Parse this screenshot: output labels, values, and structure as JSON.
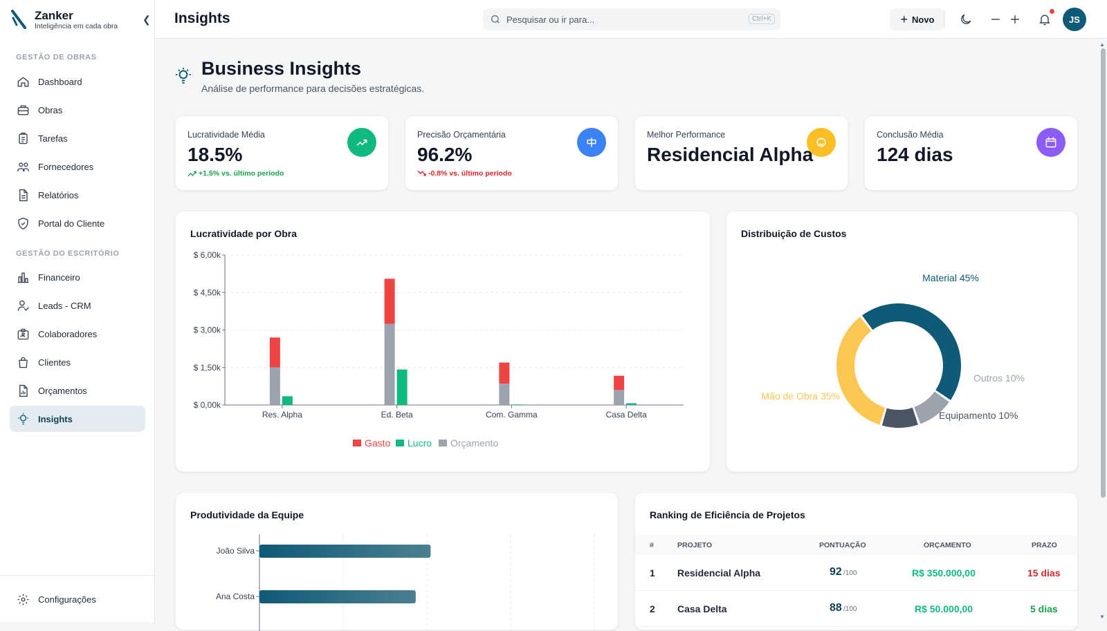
{
  "brand": {
    "name": "Zanker",
    "tagline": "Inteligência em cada obra"
  },
  "sidebar": {
    "section1": "GESTÃO DE OBRAS",
    "section2": "GESTÃO DO ESCRITÓRIO",
    "items": [
      {
        "label": "Dashboard",
        "icon": "home-icon"
      },
      {
        "label": "Obras",
        "icon": "briefcase-icon"
      },
      {
        "label": "Tarefas",
        "icon": "clipboard-icon"
      },
      {
        "label": "Fornecedores",
        "icon": "users-icon"
      },
      {
        "label": "Relatórios",
        "icon": "file-icon"
      },
      {
        "label": "Portal do Cliente",
        "icon": "shield-icon"
      },
      {
        "label": "Financeiro",
        "icon": "bar-chart-icon"
      },
      {
        "label": "Leads - CRM",
        "icon": "user-handshake-icon"
      },
      {
        "label": "Colaboradores",
        "icon": "id-badge-icon"
      },
      {
        "label": "Clientes",
        "icon": "shopping-bag-icon"
      },
      {
        "label": "Orçamentos",
        "icon": "file-chart-icon"
      },
      {
        "label": "Insights",
        "icon": "lightbulb-icon",
        "active": true
      }
    ],
    "settings": "Configurações"
  },
  "topbar": {
    "title": "Insights",
    "search_placeholder": "Pesquisar ou ir para...",
    "shortcut": "Ctrl+K",
    "new_label": "Novo",
    "avatar_initials": "JS"
  },
  "header": {
    "title": "Business Insights",
    "subtitle": "Análise de performance para decisões estratégicas."
  },
  "kpis": [
    {
      "label": "Lucratividade Média",
      "value": "18.5%",
      "delta": "+1.5% vs. último período",
      "delta_color": "#16a34a",
      "icon": "trending-up-icon",
      "icon_bg": "#10b981"
    },
    {
      "label": "Precisão Orçamentária",
      "value": "96.2%",
      "delta": "-0.8% vs. último período",
      "delta_color": "#dc2626",
      "icon": "target-icon",
      "icon_bg": "#3b82f6"
    },
    {
      "label": "Melhor Performance",
      "value": "Residencial Alpha",
      "delta": "",
      "icon": "award-icon",
      "icon_bg": "#fbbf24"
    },
    {
      "label": "Conclusão Média",
      "value": "124 dias",
      "delta": "",
      "icon": "calendar-icon",
      "icon_bg": "#8b5cf6"
    }
  ],
  "profit_chart": {
    "title": "Lucratividade por Obra",
    "chart_data": {
      "type": "bar",
      "categories": [
        "Res. Alpha",
        "Ed. Beta",
        "Com. Gamma",
        "Casa Delta"
      ],
      "series": [
        {
          "name": "Gasto",
          "color": "#ef4444",
          "values": [
            2700,
            5050,
            1700,
            1170
          ]
        },
        {
          "name": "Lucro",
          "color": "#10b981",
          "values": [
            350,
            1420,
            20,
            70
          ]
        },
        {
          "name": "Orçamento",
          "color": "#9ca3af",
          "values": [
            1500,
            3250,
            850,
            600
          ]
        }
      ],
      "yticks": [
        "$ 0,00k",
        "$ 1,50k",
        "$ 3,00k",
        "$ 4,50k",
        "$ 6,00k"
      ],
      "ylim": [
        0,
        6000
      ],
      "legend": "bottom"
    }
  },
  "cost_chart": {
    "title": "Distribuição de Custos",
    "chart_data": {
      "type": "pie",
      "slices": [
        {
          "label": "Material 45%",
          "value": 45,
          "color": "#0f5a77"
        },
        {
          "label": "Outros 10%",
          "value": 10,
          "color": "#9ca3af"
        },
        {
          "label": "Equipamento 10%",
          "value": 10,
          "color": "#4b5563"
        },
        {
          "label": "Mão de Obra 35%",
          "value": 35,
          "color": "#fcc653"
        }
      ]
    }
  },
  "team": {
    "title": "Produtividade da Equipe",
    "chart_data": {
      "type": "bar",
      "categories": [
        "João Silva",
        "Ana Costa"
      ],
      "values": [
        92,
        84
      ],
      "xlim": [
        0,
        180
      ]
    }
  },
  "ranking": {
    "title": "Ranking de Eficiência de Projetos",
    "headers": [
      "#",
      "PROJETO",
      "PONTUAÇÃO",
      "ORÇAMENTO",
      "PRAZO"
    ],
    "rows": [
      {
        "rank": "1",
        "project": "Residencial Alpha",
        "score": "92",
        "score_suffix": "/100",
        "budget": "R$ 350.000,00",
        "deadline": "15 dias",
        "deadline_color": "#dc2626"
      },
      {
        "rank": "2",
        "project": "Casa Delta",
        "score": "88",
        "score_suffix": "/100",
        "budget": "R$ 50.000,00",
        "deadline": "5 dias",
        "deadline_color": "#16a34a"
      }
    ]
  }
}
